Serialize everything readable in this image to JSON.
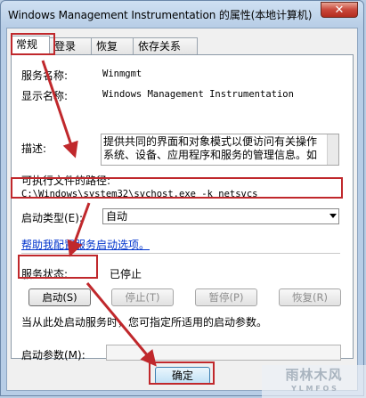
{
  "window": {
    "title": "Windows Management Instrumentation 的属性(本地计算机)",
    "close_glyph": "✕"
  },
  "tabs": [
    {
      "label": "常规",
      "active": true
    },
    {
      "label": "登录",
      "active": false
    },
    {
      "label": "恢复",
      "active": false
    },
    {
      "label": "依存关系",
      "active": false
    }
  ],
  "general": {
    "service_name_label": "服务名称:",
    "service_name_value": "Winmgmt",
    "display_name_label": "显示名称:",
    "display_name_value": "Windows Management Instrumentation",
    "description_label": "描述:",
    "description_value": "提供共同的界面和对象模式以便访问有关操作系统、设备、应用程序和服务的管理信息。如",
    "exec_path_label": "可执行文件的路径:",
    "exec_path_value": "C:\\Windows\\system32\\svchost.exe -k netsvcs",
    "startup_type_label": "启动类型(E):",
    "startup_type_value": "自动",
    "help_link": "帮助我配置服务启动选项。",
    "status_label": "服务状态:",
    "status_value": "已停止",
    "buttons": {
      "start": "启动(S)",
      "stop": "停止(T)",
      "pause": "暂停(P)",
      "resume": "恢复(R)"
    },
    "hint_text": "当从此处启动服务时，您可指定所适用的启动参数。",
    "start_params_label": "启动参数(M):",
    "start_params_value": ""
  },
  "footer": {
    "ok": "确定"
  },
  "watermark": {
    "text": "雨林木风",
    "sub": "Y L M F O S"
  },
  "colors": {
    "highlight": "#c0282c",
    "link": "#0033cc"
  }
}
